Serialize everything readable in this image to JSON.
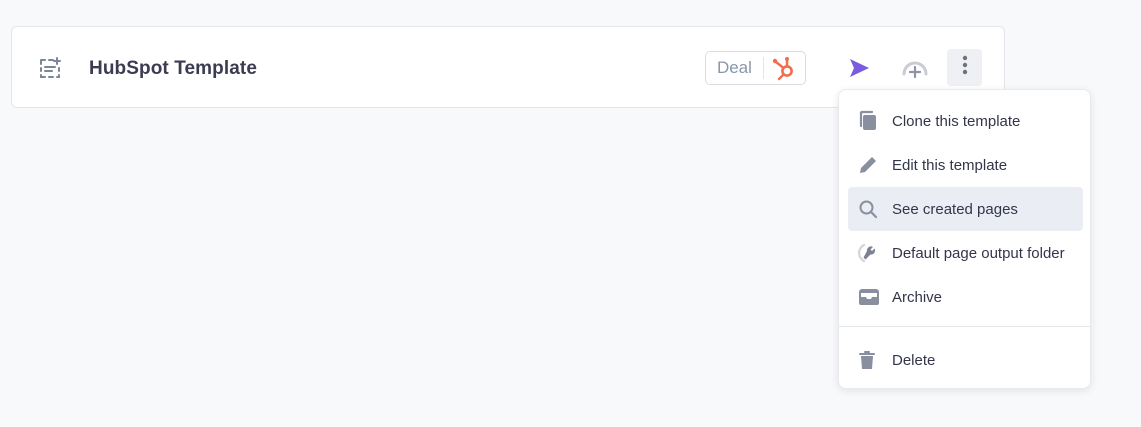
{
  "template": {
    "icon": "template-icon",
    "title": "HubSpot Template",
    "badge_label": "Deal",
    "badge_icon": "hubspot-icon",
    "hubspot_color": "#f26d4f"
  },
  "actions": {
    "run_icon": "play-icon",
    "run_color": "#7b5ce0",
    "output_icon": "gauge-plus-icon",
    "more_icon": "more-vertical-icon"
  },
  "menu": {
    "items": [
      {
        "label": "Clone this template",
        "icon": "copy-icon"
      },
      {
        "label": "Edit this template",
        "icon": "pencil-icon"
      },
      {
        "label": "See created pages",
        "icon": "search-icon",
        "active": true
      },
      {
        "label": "Default page output folder",
        "icon": "wrench-icon"
      },
      {
        "label": "Archive",
        "icon": "archive-icon"
      }
    ],
    "danger_items": [
      {
        "label": "Delete",
        "icon": "trash-icon"
      }
    ]
  }
}
